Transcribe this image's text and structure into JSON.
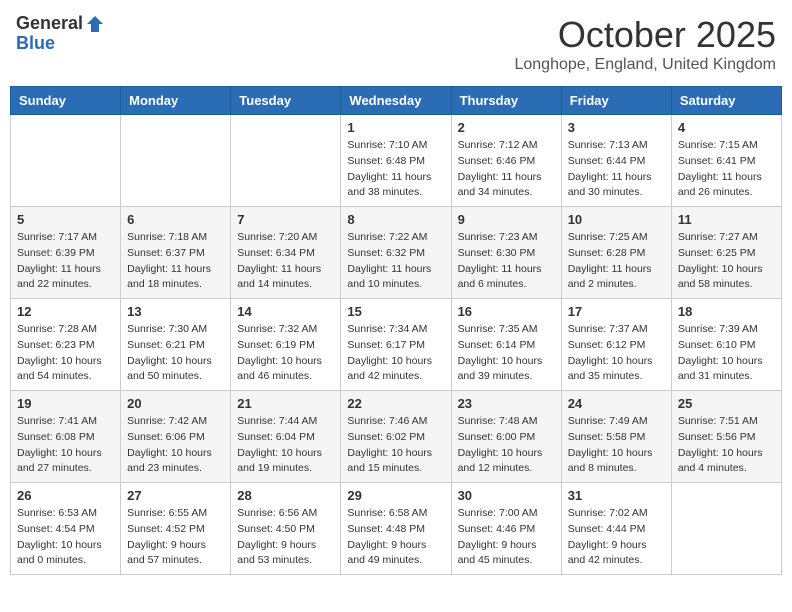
{
  "header": {
    "logo_general": "General",
    "logo_blue": "Blue",
    "month_title": "October 2025",
    "location": "Longhope, England, United Kingdom"
  },
  "days_of_week": [
    "Sunday",
    "Monday",
    "Tuesday",
    "Wednesday",
    "Thursday",
    "Friday",
    "Saturday"
  ],
  "weeks": [
    [
      {
        "day": "",
        "info": ""
      },
      {
        "day": "",
        "info": ""
      },
      {
        "day": "",
        "info": ""
      },
      {
        "day": "1",
        "info": "Sunrise: 7:10 AM\nSunset: 6:48 PM\nDaylight: 11 hours\nand 38 minutes."
      },
      {
        "day": "2",
        "info": "Sunrise: 7:12 AM\nSunset: 6:46 PM\nDaylight: 11 hours\nand 34 minutes."
      },
      {
        "day": "3",
        "info": "Sunrise: 7:13 AM\nSunset: 6:44 PM\nDaylight: 11 hours\nand 30 minutes."
      },
      {
        "day": "4",
        "info": "Sunrise: 7:15 AM\nSunset: 6:41 PM\nDaylight: 11 hours\nand 26 minutes."
      }
    ],
    [
      {
        "day": "5",
        "info": "Sunrise: 7:17 AM\nSunset: 6:39 PM\nDaylight: 11 hours\nand 22 minutes."
      },
      {
        "day": "6",
        "info": "Sunrise: 7:18 AM\nSunset: 6:37 PM\nDaylight: 11 hours\nand 18 minutes."
      },
      {
        "day": "7",
        "info": "Sunrise: 7:20 AM\nSunset: 6:34 PM\nDaylight: 11 hours\nand 14 minutes."
      },
      {
        "day": "8",
        "info": "Sunrise: 7:22 AM\nSunset: 6:32 PM\nDaylight: 11 hours\nand 10 minutes."
      },
      {
        "day": "9",
        "info": "Sunrise: 7:23 AM\nSunset: 6:30 PM\nDaylight: 11 hours\nand 6 minutes."
      },
      {
        "day": "10",
        "info": "Sunrise: 7:25 AM\nSunset: 6:28 PM\nDaylight: 11 hours\nand 2 minutes."
      },
      {
        "day": "11",
        "info": "Sunrise: 7:27 AM\nSunset: 6:25 PM\nDaylight: 10 hours\nand 58 minutes."
      }
    ],
    [
      {
        "day": "12",
        "info": "Sunrise: 7:28 AM\nSunset: 6:23 PM\nDaylight: 10 hours\nand 54 minutes."
      },
      {
        "day": "13",
        "info": "Sunrise: 7:30 AM\nSunset: 6:21 PM\nDaylight: 10 hours\nand 50 minutes."
      },
      {
        "day": "14",
        "info": "Sunrise: 7:32 AM\nSunset: 6:19 PM\nDaylight: 10 hours\nand 46 minutes."
      },
      {
        "day": "15",
        "info": "Sunrise: 7:34 AM\nSunset: 6:17 PM\nDaylight: 10 hours\nand 42 minutes."
      },
      {
        "day": "16",
        "info": "Sunrise: 7:35 AM\nSunset: 6:14 PM\nDaylight: 10 hours\nand 39 minutes."
      },
      {
        "day": "17",
        "info": "Sunrise: 7:37 AM\nSunset: 6:12 PM\nDaylight: 10 hours\nand 35 minutes."
      },
      {
        "day": "18",
        "info": "Sunrise: 7:39 AM\nSunset: 6:10 PM\nDaylight: 10 hours\nand 31 minutes."
      }
    ],
    [
      {
        "day": "19",
        "info": "Sunrise: 7:41 AM\nSunset: 6:08 PM\nDaylight: 10 hours\nand 27 minutes."
      },
      {
        "day": "20",
        "info": "Sunrise: 7:42 AM\nSunset: 6:06 PM\nDaylight: 10 hours\nand 23 minutes."
      },
      {
        "day": "21",
        "info": "Sunrise: 7:44 AM\nSunset: 6:04 PM\nDaylight: 10 hours\nand 19 minutes."
      },
      {
        "day": "22",
        "info": "Sunrise: 7:46 AM\nSunset: 6:02 PM\nDaylight: 10 hours\nand 15 minutes."
      },
      {
        "day": "23",
        "info": "Sunrise: 7:48 AM\nSunset: 6:00 PM\nDaylight: 10 hours\nand 12 minutes."
      },
      {
        "day": "24",
        "info": "Sunrise: 7:49 AM\nSunset: 5:58 PM\nDaylight: 10 hours\nand 8 minutes."
      },
      {
        "day": "25",
        "info": "Sunrise: 7:51 AM\nSunset: 5:56 PM\nDaylight: 10 hours\nand 4 minutes."
      }
    ],
    [
      {
        "day": "26",
        "info": "Sunrise: 6:53 AM\nSunset: 4:54 PM\nDaylight: 10 hours\nand 0 minutes."
      },
      {
        "day": "27",
        "info": "Sunrise: 6:55 AM\nSunset: 4:52 PM\nDaylight: 9 hours\nand 57 minutes."
      },
      {
        "day": "28",
        "info": "Sunrise: 6:56 AM\nSunset: 4:50 PM\nDaylight: 9 hours\nand 53 minutes."
      },
      {
        "day": "29",
        "info": "Sunrise: 6:58 AM\nSunset: 4:48 PM\nDaylight: 9 hours\nand 49 minutes."
      },
      {
        "day": "30",
        "info": "Sunrise: 7:00 AM\nSunset: 4:46 PM\nDaylight: 9 hours\nand 45 minutes."
      },
      {
        "day": "31",
        "info": "Sunrise: 7:02 AM\nSunset: 4:44 PM\nDaylight: 9 hours\nand 42 minutes."
      },
      {
        "day": "",
        "info": ""
      }
    ]
  ]
}
